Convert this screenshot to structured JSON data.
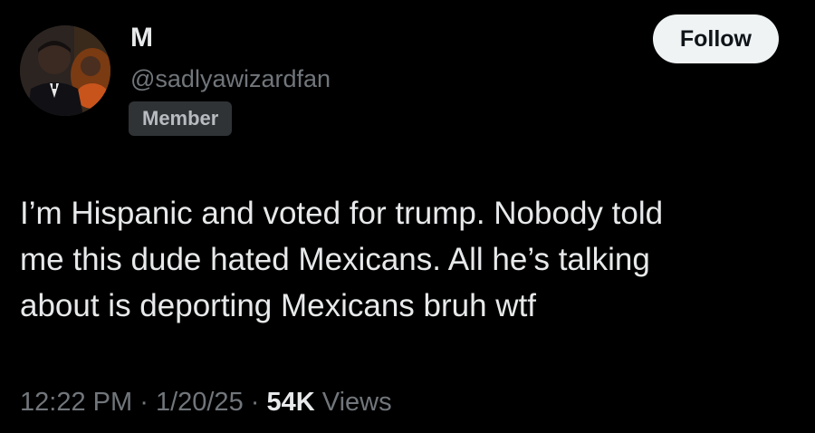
{
  "user": {
    "display_name": "M",
    "handle": "@sadlyawizardfan",
    "badge": "Member"
  },
  "actions": {
    "follow_label": "Follow"
  },
  "tweet": {
    "lines": [
      "I’m Hispanic and voted for trump. Nobody told",
      "me this dude hated Mexicans. All he’s talking",
      "about is deporting Mexicans bruh wtf"
    ]
  },
  "meta": {
    "time": "12:22 PM",
    "separator": "·",
    "date": "1/20/25",
    "views_count": "54K",
    "views_label": "Views"
  }
}
